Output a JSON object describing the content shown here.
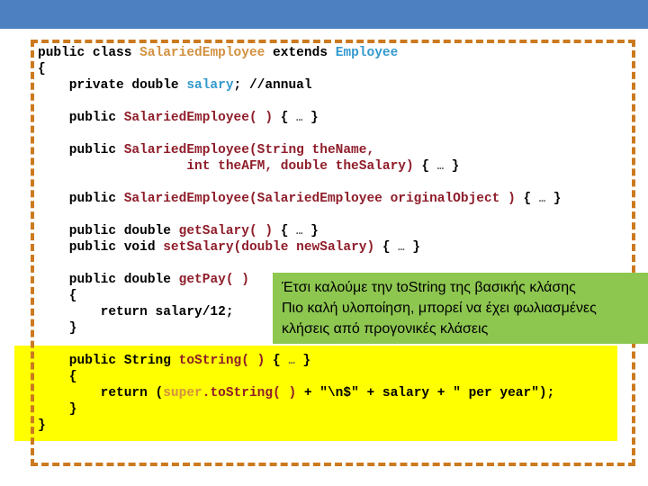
{
  "banner": {
    "color": "#4d80c0"
  },
  "frame": {
    "border_color": "#cc7a1f",
    "style": "dashed"
  },
  "highlight": {
    "color": "#ffff00"
  },
  "callout": {
    "background": "#8ec750",
    "lines": [
      "Έτσι καλούμε την toString της βασικής κλάσης",
      "Πιο καλή υλοποίηση, μπορεί να έχει φωλιασμένες",
      "κλήσεις από προγονικές κλάσεις"
    ]
  },
  "colors": {
    "plain": "#000000",
    "class_name": "#d39141",
    "field": "#3399cc",
    "member": "#8f1d2a",
    "highlight": "#ffff00",
    "callout": "#8ec750",
    "frame": "#cc7a1f",
    "banner": "#4d80c0"
  },
  "code": {
    "language": "java",
    "lines": [
      {
        "index": 1,
        "tokens": [
          {
            "t": "public class ",
            "c": "plain"
          },
          {
            "t": "SalariedEmployee",
            "c": "class_name"
          },
          {
            "t": " extends ",
            "c": "plain"
          },
          {
            "t": "Employee",
            "c": "field"
          }
        ]
      },
      {
        "index": 2,
        "tokens": [
          {
            "t": "{",
            "c": "plain"
          }
        ]
      },
      {
        "index": 3,
        "tokens": [
          {
            "t": "    private double ",
            "c": "plain"
          },
          {
            "t": "salary",
            "c": "field"
          },
          {
            "t": "; //annual",
            "c": "plain"
          }
        ]
      },
      {
        "index": 4,
        "tokens": []
      },
      {
        "index": 5,
        "tokens": [
          {
            "t": "    public ",
            "c": "plain"
          },
          {
            "t": "SalariedEmployee( )",
            "c": "member"
          },
          {
            "t": " { ",
            "c": "plain"
          },
          {
            "t": "…",
            "c": "ellipsis"
          },
          {
            "t": " }",
            "c": "plain"
          }
        ]
      },
      {
        "index": 6,
        "tokens": []
      },
      {
        "index": 7,
        "tokens": [
          {
            "t": "    public ",
            "c": "plain"
          },
          {
            "t": "SalariedEmployee(String theName,",
            "c": "member"
          }
        ]
      },
      {
        "index": 8,
        "tokens": [
          {
            "t": "                   ",
            "c": "plain"
          },
          {
            "t": "int theAFM, double theSalary)",
            "c": "member"
          },
          {
            "t": " { ",
            "c": "plain"
          },
          {
            "t": "…",
            "c": "ellipsis"
          },
          {
            "t": " }",
            "c": "plain"
          }
        ]
      },
      {
        "index": 9,
        "tokens": []
      },
      {
        "index": 10,
        "tokens": [
          {
            "t": "    public ",
            "c": "plain"
          },
          {
            "t": "SalariedEmployee(SalariedEmployee originalObject )",
            "c": "member"
          },
          {
            "t": " { ",
            "c": "plain"
          },
          {
            "t": "…",
            "c": "ellipsis"
          },
          {
            "t": " }",
            "c": "plain"
          }
        ]
      },
      {
        "index": 11,
        "tokens": []
      },
      {
        "index": 12,
        "tokens": [
          {
            "t": "    public double ",
            "c": "plain"
          },
          {
            "t": "getSalary( )",
            "c": "member"
          },
          {
            "t": " { ",
            "c": "plain"
          },
          {
            "t": "…",
            "c": "ellipsis"
          },
          {
            "t": " }",
            "c": "plain"
          }
        ]
      },
      {
        "index": 13,
        "tokens": [
          {
            "t": "    public void ",
            "c": "plain"
          },
          {
            "t": "setSalary(double newSalary)",
            "c": "member"
          },
          {
            "t": " { ",
            "c": "plain"
          },
          {
            "t": "…",
            "c": "ellipsis"
          },
          {
            "t": " }",
            "c": "plain"
          }
        ]
      },
      {
        "index": 14,
        "tokens": []
      },
      {
        "index": 15,
        "tokens": [
          {
            "t": "    public double ",
            "c": "plain"
          },
          {
            "t": "getPay( )",
            "c": "member"
          }
        ]
      },
      {
        "index": 16,
        "tokens": [
          {
            "t": "    {",
            "c": "plain"
          }
        ]
      },
      {
        "index": 17,
        "tokens": [
          {
            "t": "        return salary/12;",
            "c": "plain"
          }
        ]
      },
      {
        "index": 18,
        "tokens": [
          {
            "t": "    }",
            "c": "plain"
          }
        ]
      },
      {
        "index": 19,
        "tokens": []
      },
      {
        "index": 20,
        "tokens": [
          {
            "t": "    public String ",
            "c": "plain"
          },
          {
            "t": "toString( )",
            "c": "member"
          },
          {
            "t": " { ",
            "c": "plain"
          },
          {
            "t": "…",
            "c": "ellipsis"
          },
          {
            "t": " }",
            "c": "plain"
          }
        ]
      },
      {
        "index": 21,
        "tokens": [
          {
            "t": "    {",
            "c": "plain"
          }
        ]
      },
      {
        "index": 22,
        "tokens": [
          {
            "t": "        return (",
            "c": "plain"
          },
          {
            "t": "super",
            "c": "class_name"
          },
          {
            "t": ".toString( )",
            "c": "member"
          },
          {
            "t": " + \"\\n$\" + salary + \" per year\");",
            "c": "plain"
          }
        ]
      },
      {
        "index": 23,
        "tokens": [
          {
            "t": "    }",
            "c": "plain"
          }
        ]
      },
      {
        "index": 24,
        "tokens": [
          {
            "t": "}",
            "c": "plain"
          }
        ]
      }
    ]
  }
}
